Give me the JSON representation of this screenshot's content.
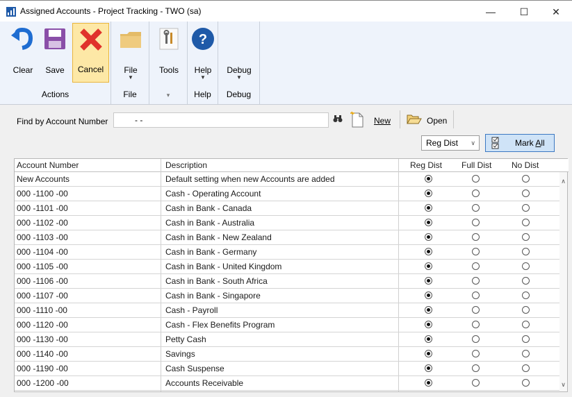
{
  "window": {
    "title": "Assigned Accounts - Project Tracking  -  TWO (sa)",
    "minimize": "—",
    "maximize": "☐",
    "close": "✕"
  },
  "ribbon": {
    "groups": [
      {
        "label": "Actions",
        "buttons": [
          {
            "label": "Clear",
            "icon": "undo-icon"
          },
          {
            "label": "Save",
            "icon": "save-icon"
          },
          {
            "label": "Cancel",
            "icon": "cancel-icon"
          }
        ]
      },
      {
        "label": "File",
        "buttons": [
          {
            "label": "File",
            "icon": "folder-icon"
          }
        ]
      },
      {
        "label": "▾",
        "buttons": [
          {
            "label": "Tools",
            "icon": "tools-icon"
          }
        ]
      },
      {
        "label": "Help",
        "buttons": [
          {
            "label": "Help",
            "icon": "help-icon"
          }
        ]
      },
      {
        "label": "Debug",
        "buttons": [
          {
            "label": "Debug",
            "icon": "debug-icon"
          }
        ]
      }
    ]
  },
  "find": {
    "label": "Find by Account Number",
    "value": "-        -",
    "new_label": "New",
    "open_label": "Open"
  },
  "filter": {
    "selected": "Reg Dist",
    "mark_all": "Mark ",
    "mark_all_u": "A",
    "mark_all_rest": "ll"
  },
  "grid": {
    "columns": [
      "Account Number",
      "Description",
      "Reg Dist",
      "Full Dist",
      "No Dist"
    ],
    "rows": [
      {
        "account": "New Accounts",
        "description": "Default setting when new Accounts are added",
        "selected": 0
      },
      {
        "account": "000 -1100 -00",
        "description": "Cash - Operating Account",
        "selected": 0
      },
      {
        "account": "000 -1101 -00",
        "description": "Cash in Bank - Canada",
        "selected": 0
      },
      {
        "account": "000 -1102 -00",
        "description": "Cash in Bank - Australia",
        "selected": 0
      },
      {
        "account": "000 -1103 -00",
        "description": "Cash in Bank - New Zealand",
        "selected": 0
      },
      {
        "account": "000 -1104 -00",
        "description": "Cash in Bank - Germany",
        "selected": 0
      },
      {
        "account": "000 -1105 -00",
        "description": "Cash in Bank - United Kingdom",
        "selected": 0
      },
      {
        "account": "000 -1106 -00",
        "description": "Cash in Bank - South Africa",
        "selected": 0
      },
      {
        "account": "000 -1107 -00",
        "description": "Cash in Bank - Singapore",
        "selected": 0
      },
      {
        "account": "000 -1110 -00",
        "description": "Cash - Payroll",
        "selected": 0
      },
      {
        "account": "000 -1120 -00",
        "description": "Cash - Flex Benefits Program",
        "selected": 0
      },
      {
        "account": "000 -1130 -00",
        "description": "Petty Cash",
        "selected": 0
      },
      {
        "account": "000 -1140 -00",
        "description": "Savings",
        "selected": 0
      },
      {
        "account": "000 -1190 -00",
        "description": "Cash Suspense",
        "selected": 0
      },
      {
        "account": "000 -1200 -00",
        "description": "Accounts Receivable",
        "selected": 0
      }
    ]
  },
  "colors": {
    "highlight": "#ffff38",
    "ribbon_bg": "#eef3fb",
    "active_button": "#fde8a6",
    "mark_all_bg": "#cfe3f7"
  }
}
